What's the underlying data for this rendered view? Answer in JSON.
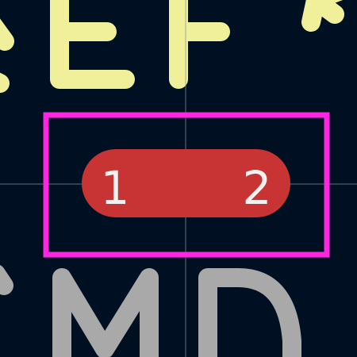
{
  "viewer": {
    "background": "#001023",
    "crosshair_color": "#8a8f99"
  },
  "silkscreen_ref": {
    "text": "REF**",
    "color": "#f0f09b"
  },
  "courtyard": {
    "color": "#ff26e2"
  },
  "pad": {
    "color": "#c83434",
    "pin_labels": [
      "1",
      "2"
    ]
  },
  "fab_value": {
    "text": "SMD",
    "color": "#a9a9a9"
  }
}
